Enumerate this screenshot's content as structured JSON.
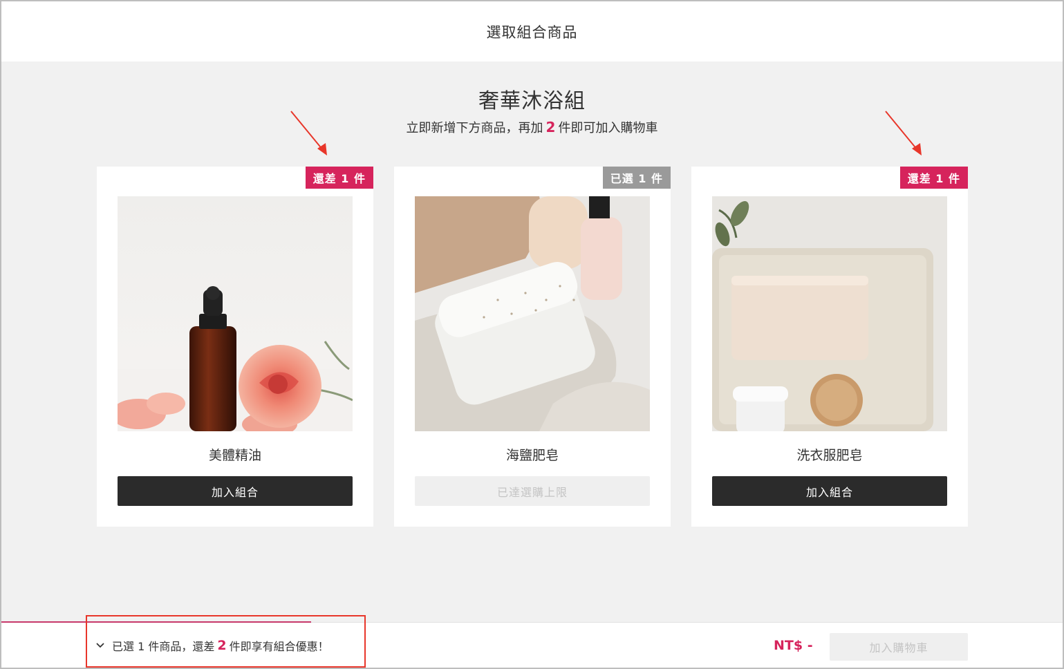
{
  "header": {
    "title": "選取組合商品"
  },
  "bundle": {
    "title": "奢華沐浴組",
    "subtitle_pre": "立即新增下方商品，再加",
    "subtitle_count": "2",
    "subtitle_post": "件即可加入購物車"
  },
  "products": [
    {
      "name": "美體精油",
      "badge": "還差 1 件",
      "badge_state": "need",
      "button": "加入組合",
      "button_state": "enabled",
      "image": "essential-oil-rose-photo"
    },
    {
      "name": "海鹽肥皂",
      "badge": "已選 1 件",
      "badge_state": "done",
      "button": "已達選購上限",
      "button_state": "disabled",
      "image": "sea-salt-soap-photo"
    },
    {
      "name": "洗衣服肥皂",
      "badge": "還差 1 件",
      "badge_state": "need",
      "button": "加入組合",
      "button_state": "enabled",
      "image": "laundry-soap-photo"
    }
  ],
  "footer": {
    "summary_pre": "已選 1 件商品，還差",
    "summary_count": "2",
    "summary_post": "件即享有組合優惠！",
    "price": "NT$ -",
    "cart_button": "加入購物車",
    "progress_fraction": 0.29
  },
  "colors": {
    "accent": "#d6245c",
    "annotation": "#e8362a",
    "dark_button": "#2b2b2b",
    "badge_done": "#9a9a9a"
  },
  "icons": {
    "summary_toggle": "chevron-down-icon"
  }
}
